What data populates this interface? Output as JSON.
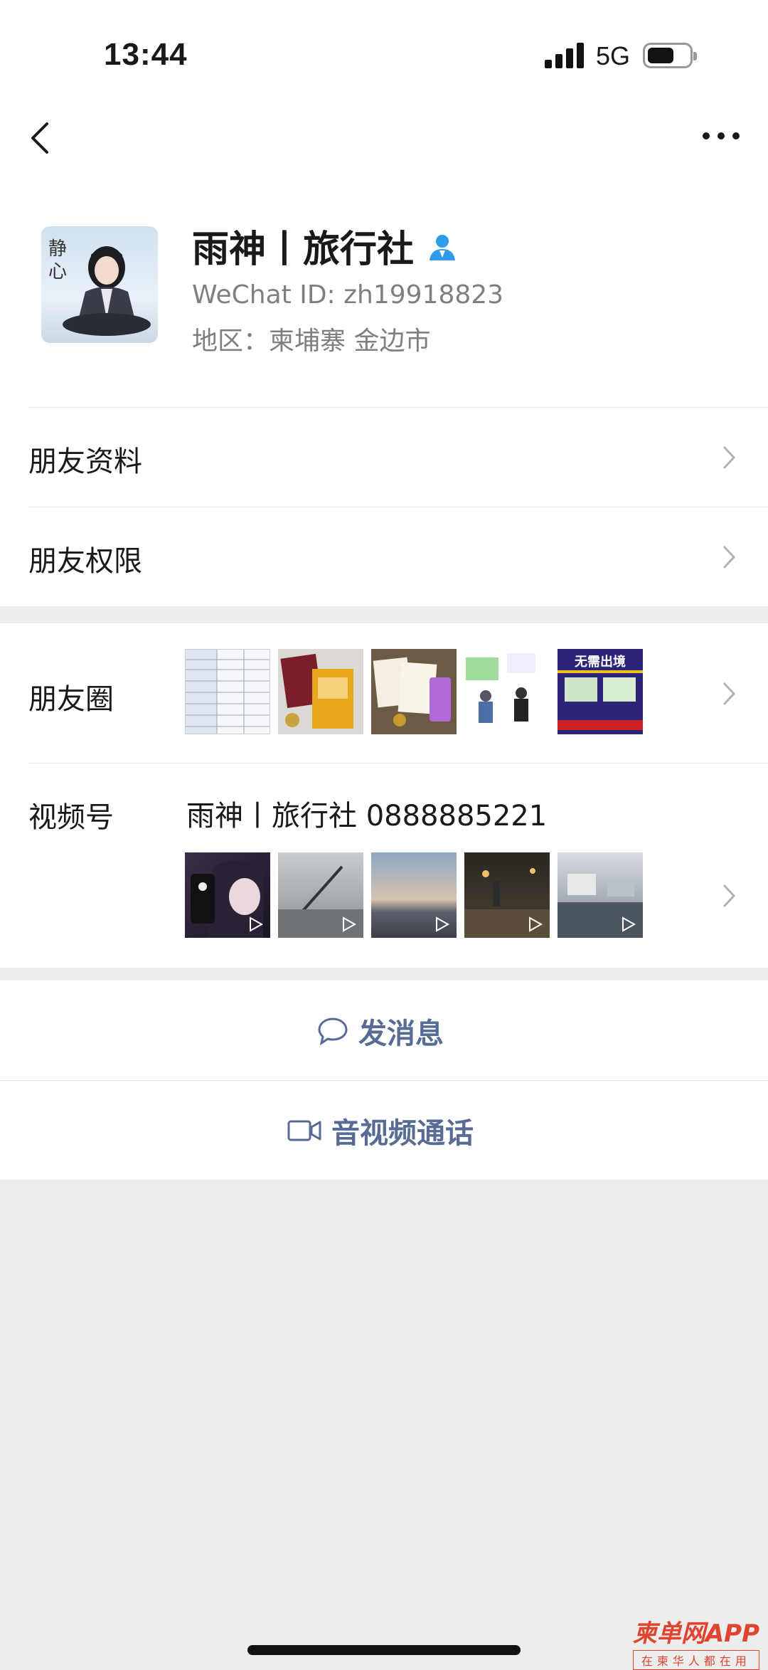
{
  "status_bar": {
    "time": "13:44",
    "network": "5G",
    "battery_percent": 65
  },
  "nav": {
    "back_icon": "chevron-left-icon",
    "more_icon": "more-dots-icon"
  },
  "profile": {
    "name": "雨神丨旅行社",
    "verified_icon": "person-verified-icon",
    "wechat_id": "WeChat ID: zh19918823",
    "region": "地区：柬埔寨 金边市"
  },
  "menu": {
    "friend_info": "朋友资料",
    "friend_permissions": "朋友权限",
    "moments": "朋友圈",
    "channels": "视频号",
    "channels_name": "雨神丨旅行社 0888885221"
  },
  "moments_thumbs": [
    "document-table",
    "passport-photo",
    "certificates",
    "id-cards",
    "no-need-exit-flyer"
  ],
  "moments_flyer_text": "无需出境",
  "channel_thumbs": [
    "anime-selfie",
    "rainy-windshield",
    "sunset-beach",
    "night-street",
    "rainy-road"
  ],
  "actions": {
    "send_message": "发消息",
    "av_call": "音视频通话"
  },
  "watermark": {
    "brand": "柬单网APP",
    "slogan": "在柬华人都在用"
  },
  "colors": {
    "link_blue": "#576b95",
    "verified_blue": "#2f9be9",
    "background": "#ededed"
  }
}
